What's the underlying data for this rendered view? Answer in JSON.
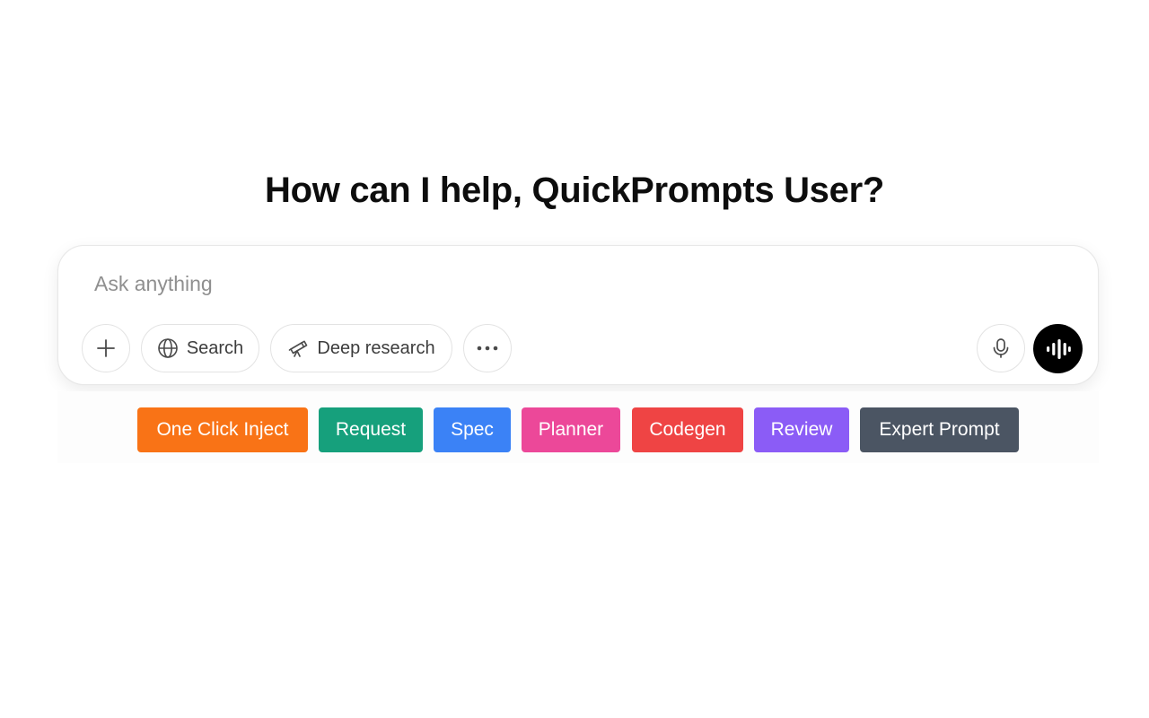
{
  "heading": "How can I help, QuickPrompts User?",
  "composer": {
    "placeholder": "Ask anything",
    "buttons": {
      "add_icon": "plus-icon",
      "search_label": "Search",
      "search_icon": "globe-icon",
      "deep_research_label": "Deep research",
      "deep_research_icon": "telescope-icon",
      "more_icon": "ellipsis-icon",
      "mic_icon": "microphone-icon",
      "voice_icon": "voice-mode-icon"
    }
  },
  "quick_prompts": [
    {
      "label": "One Click Inject",
      "color": "#f97316"
    },
    {
      "label": "Request",
      "color": "#16a07c"
    },
    {
      "label": "Spec",
      "color": "#3b82f6"
    },
    {
      "label": "Planner",
      "color": "#ec4899"
    },
    {
      "label": "Codegen",
      "color": "#ef4444"
    },
    {
      "label": "Review",
      "color": "#8b5cf6"
    },
    {
      "label": "Expert Prompt",
      "color": "#4b5563"
    }
  ]
}
